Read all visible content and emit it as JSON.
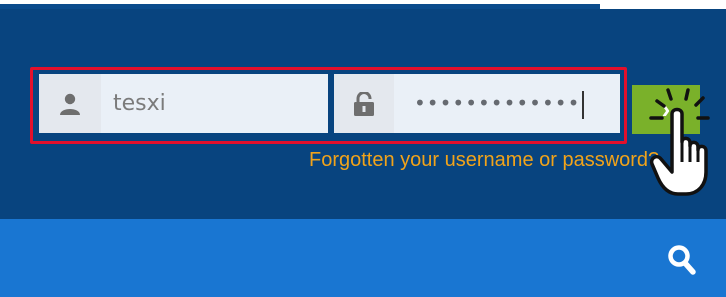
{
  "login": {
    "username_value": "tesxi",
    "password_value": "•••••••••••••",
    "submit_glyph": "›",
    "forgot_link": "Forgotten your username or password?"
  },
  "icons": {
    "user": "user-icon",
    "lock": "unlock-icon",
    "search": "search-icon",
    "cursor": "hand-pointer-icon"
  },
  "colors": {
    "header_bg": "#08447f",
    "navbar_bg": "#1976d2",
    "highlight_border": "#e3102b",
    "submit_bg": "#7ab12a",
    "link": "#f1a31a"
  }
}
